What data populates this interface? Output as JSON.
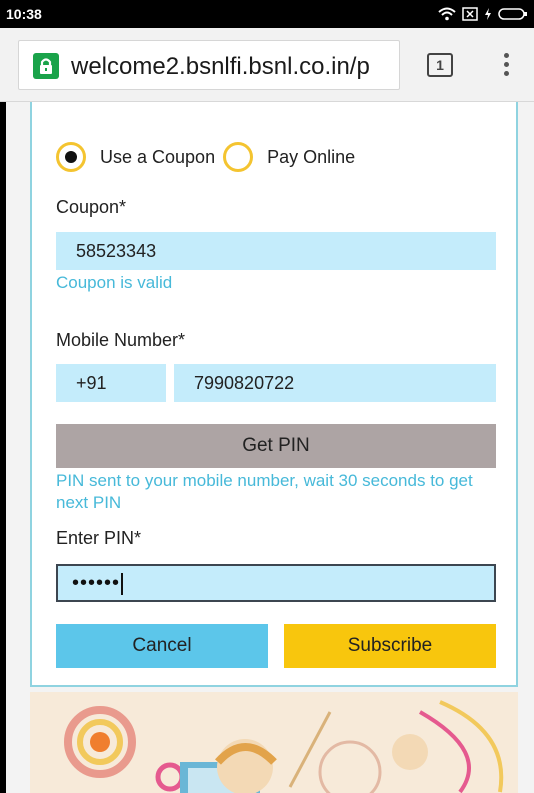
{
  "status_bar": {
    "time": "10:38",
    "icons": [
      "wifi-icon",
      "sim-icon",
      "battery-charging-icon"
    ]
  },
  "browser": {
    "url": "welcome2.bsnlfi.bsnl.co.in/p",
    "tab_count": "1",
    "lock_color": "#1aa34a"
  },
  "form": {
    "payment_options": [
      {
        "label": "Use a Coupon",
        "selected": true
      },
      {
        "label": "Pay Online",
        "selected": false
      }
    ],
    "coupon": {
      "label": "Coupon*",
      "value": "58523343",
      "status": "Coupon is valid"
    },
    "mobile": {
      "label": "Mobile Number*",
      "country_code": "+91",
      "number": "7990820722"
    },
    "get_pin_label": "Get PIN",
    "pin_sent_message": "PIN sent to your mobile number, wait 30 seconds to get next PIN",
    "pin": {
      "label": "Enter PIN*",
      "masked_value": "••••••"
    },
    "cancel_label": "Cancel",
    "subscribe_label": "Subscribe"
  },
  "colors": {
    "accent_blue": "#47b9d9",
    "field_bg": "#c4ecfb",
    "radio_yellow": "#f4c430",
    "subscribe_yellow": "#f8c60d",
    "cancel_blue": "#5cc6ea",
    "get_pin_gray": "#ada4a4"
  }
}
